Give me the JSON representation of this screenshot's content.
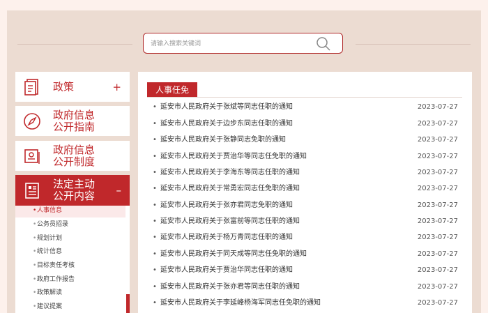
{
  "search": {
    "placeholder": "请输入搜索关键词"
  },
  "sidebar": {
    "items": [
      {
        "label": "政策",
        "toggle": "+"
      },
      {
        "label": "政府信息\n公开指南"
      },
      {
        "label": "政府信息\n公开制度"
      },
      {
        "label": "法定主动\n公开内容",
        "toggle": "–"
      }
    ],
    "submenu": [
      {
        "label": "人事信息",
        "active": true
      },
      {
        "label": "公务员招录"
      },
      {
        "label": "规划计划"
      },
      {
        "label": "统计信息"
      },
      {
        "label": "目标责任考核"
      },
      {
        "label": "政府工作报告"
      },
      {
        "label": "政策解读"
      },
      {
        "label": "建议提案"
      }
    ]
  },
  "panel": {
    "tab": "人事任免",
    "news": [
      {
        "title": "延安市人民政府关于张斌等同志任职的通知",
        "date": "2023-07-27"
      },
      {
        "title": "延安市人民政府关于边步东同志任职的通知",
        "date": "2023-07-27"
      },
      {
        "title": "延安市人民政府关于张静同志免职的通知",
        "date": "2023-07-27"
      },
      {
        "title": "延安市人民政府关于贾治华等同志任免职的通知",
        "date": "2023-07-27"
      },
      {
        "title": "延安市人民政府关于李海东等同志任职的通知",
        "date": "2023-07-27"
      },
      {
        "title": "延安市人民政府关于常勇宏同志任免职的通知",
        "date": "2023-07-27"
      },
      {
        "title": "延安市人民政府关于张亦君同志免职的通知",
        "date": "2023-07-27"
      },
      {
        "title": "延安市人民政府关于张富前等同志任职的通知",
        "date": "2023-07-27"
      },
      {
        "title": "延安市人民政府关于杨万青同志任职的通知",
        "date": "2023-07-27"
      },
      {
        "title": "延安市人民政府关于同天成等同志任免职的通知",
        "date": "2023-07-27"
      },
      {
        "title": "延安市人民政府关于贾治华同志任职的通知",
        "date": "2023-07-27"
      },
      {
        "title": "延安市人民政府关于张亦君等同志任职的通知",
        "date": "2023-07-27"
      },
      {
        "title": "延安市人民政府关于李延峰杨海军同志任免职的通知",
        "date": "2023-07-27"
      }
    ]
  },
  "colors": {
    "accent": "#c0282b",
    "background": "#ecdcd2"
  }
}
